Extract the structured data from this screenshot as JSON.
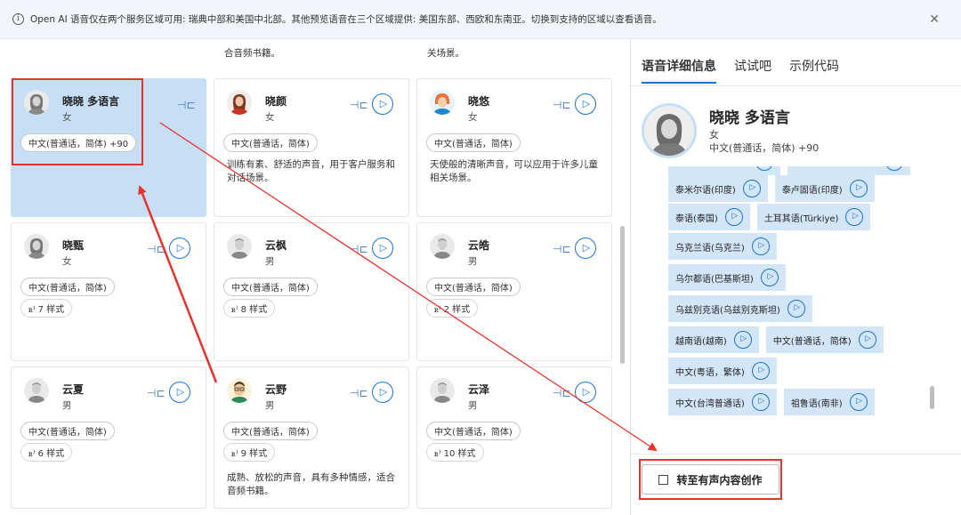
{
  "banner": {
    "info_icon": "info-icon",
    "message": "Open AI 语音仅在两个服务区域可用: 瑞典中部和美国中北部。其他预览语音在三个区域提供: 美国东部、西欧和东南亚。切换到支持的区域以查看语音。",
    "close": "✕"
  },
  "grid": {
    "top_texts": [
      "合音频书籍。",
      "关场景。"
    ],
    "cards": [
      {
        "name": "晓晓 多语言",
        "gender": "女",
        "tag": "中文(普通话，简体) +90",
        "style": "",
        "desc": [],
        "avatar": "female-gray"
      },
      {
        "name": "晓颜",
        "gender": "女",
        "tag": "中文(普通话，简体)",
        "style": "",
        "desc": [
          "训练有素、舒适的声音，用于客户服务和",
          "对话场景。"
        ],
        "avatar": "female-red"
      },
      {
        "name": "晓悠",
        "gender": "女",
        "tag": "中文(普通话，简体)",
        "style": "",
        "desc": [
          "天使般的清晰声音，可以应用于许多儿童",
          "相关场景。"
        ],
        "avatar": "child-blue"
      },
      {
        "name": "晓甄",
        "gender": "女",
        "tag": "中文(普通话，简体)",
        "style": "7 样式",
        "desc": [],
        "avatar": "female-gray"
      },
      {
        "name": "云枫",
        "gender": "男",
        "tag": "中文(普通话，简体)",
        "style": "8 样式",
        "desc": [],
        "avatar": "male-gray"
      },
      {
        "name": "云皓",
        "gender": "男",
        "tag": "中文(普通话，简体)",
        "style": "2 样式",
        "desc": [],
        "avatar": "male-gray"
      },
      {
        "name": "云夏",
        "gender": "男",
        "tag": "中文(普通话，简体)",
        "style": "6 样式",
        "desc": [],
        "avatar": "male-gray"
      },
      {
        "name": "云野",
        "gender": "男",
        "tag": "中文(普通话，简体)",
        "style": "9 样式",
        "desc": [
          "成熟、放松的声音，具有多种情感，适合",
          "音频书籍。"
        ],
        "avatar": "male-glasses"
      },
      {
        "name": "云泽",
        "gender": "男",
        "tag": "中文(普通话，简体)",
        "style": "10 样式",
        "desc": [],
        "avatar": "male-gray"
      }
    ]
  },
  "panel": {
    "tabs": [
      "语音详细信息",
      "试试吧",
      "示例代码"
    ],
    "detail": {
      "name": "晓晓 多语言",
      "gender": "女",
      "lang": "中文(普通话，简体) +90"
    },
    "languages": [
      [
        "泰米尔语(印度)",
        "泰卢固语(印度)"
      ],
      [
        "泰语(泰国)",
        "土耳其语(Türkiye)"
      ],
      [
        "乌克兰语(乌克兰)"
      ],
      [
        "乌尔都语(巴基斯坦)"
      ],
      [
        "乌兹别克语(乌兹别克斯坦)"
      ],
      [
        "越南语(越南)",
        "中文(普通话，简体)"
      ],
      [
        "中文(粤语，繁体)"
      ],
      [
        "中文(台湾普通话)",
        "祖鲁语(南非)"
      ]
    ],
    "goto_label": "转至有声内容创作"
  },
  "colors": {
    "accent": "#1b72d1",
    "selected": "#c7dff5",
    "chip": "#d3e6f8",
    "annotation": "#e8322b"
  }
}
